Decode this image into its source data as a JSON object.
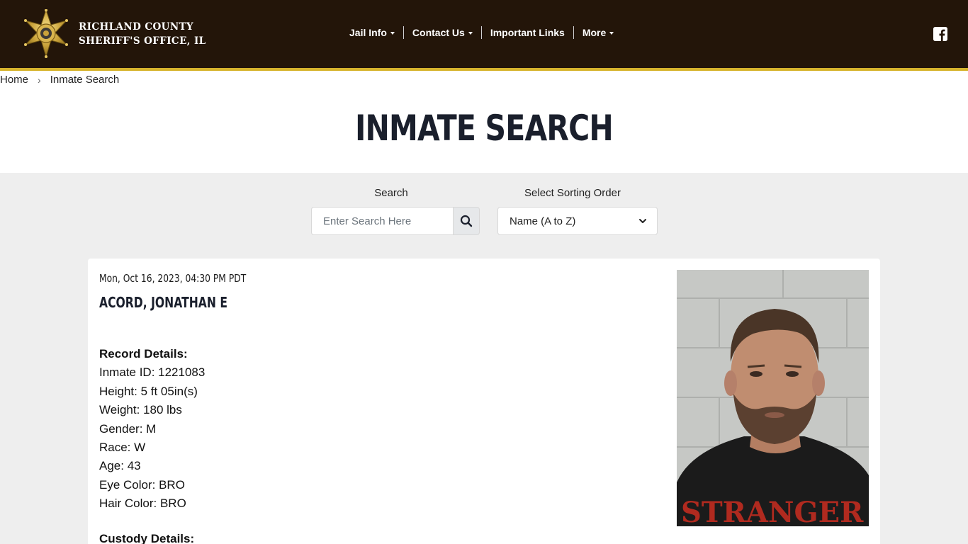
{
  "header": {
    "logo_line1": "RICHLAND COUNTY",
    "logo_line2": "SHERIFF'S OFFICE, IL",
    "nav": [
      {
        "label": "Jail Info",
        "has_dropdown": true
      },
      {
        "label": "Contact Us",
        "has_dropdown": true
      },
      {
        "label": "Important Links",
        "has_dropdown": false
      },
      {
        "label": "More",
        "has_dropdown": true
      }
    ],
    "social_icon": "facebook-icon",
    "bg_color": "#231509",
    "accent_color": "#d6b42d"
  },
  "breadcrumb": {
    "home": "Home",
    "current": "Inmate Search"
  },
  "page_title": "INMATE SEARCH",
  "search": {
    "label": "Search",
    "placeholder": "Enter Search Here",
    "value": "",
    "button_icon": "search-icon"
  },
  "sort": {
    "label": "Select Sorting Order",
    "selected": "Name (A to Z)"
  },
  "inmate": {
    "datetime": "Mon, Oct 16, 2023, 04:30 PM PDT",
    "name": "ACORD, JONATHAN E",
    "record_heading": "Record Details:",
    "inmate_id": "Inmate ID: 1221083",
    "height": "Height: 5 ft 05in(s)",
    "weight": "Weight: 180 lbs",
    "gender": "Gender: M",
    "race": "Race: W",
    "age": "Age: 43",
    "eye_color": "Eye Color: BRO",
    "hair_color": "Hair Color: BRO",
    "custody_heading": "Custody Details:",
    "shirt_text": "STRANGER"
  }
}
